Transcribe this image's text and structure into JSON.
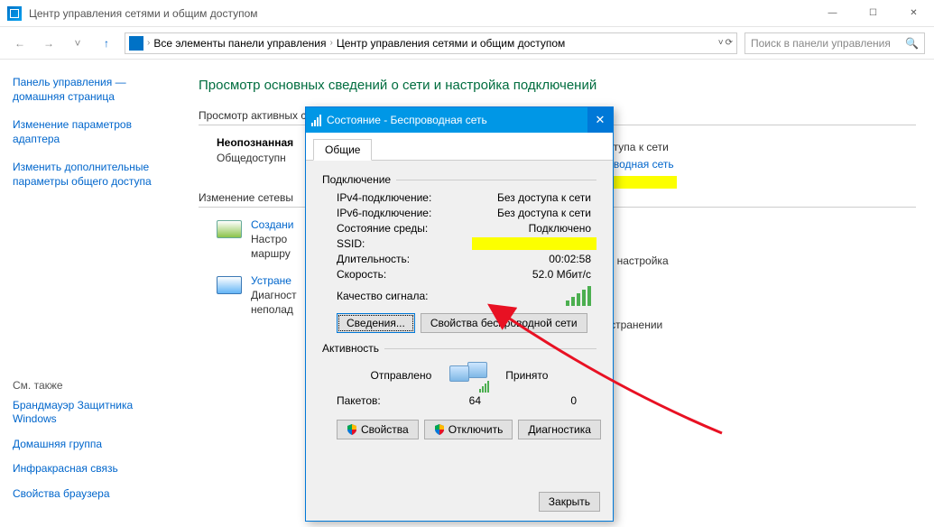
{
  "window": {
    "title": "Центр управления сетями и общим доступом",
    "min": "—",
    "max": "☐",
    "close": "✕"
  },
  "breadcrumb": {
    "item1": "Все элементы панели управления",
    "item2": "Центр управления сетями и общим доступом"
  },
  "search": {
    "placeholder": "Поиск в панели управления"
  },
  "sidebar": {
    "home": "Панель управления — домашняя страница",
    "adapter": "Изменение параметров адаптера",
    "sharing": "Изменить дополнительные параметры общего доступа",
    "related_title": "См. также",
    "related": {
      "firewall": "Брандмауэр Защитника Windows",
      "homegroup": "Домашняя группа",
      "ir": "Инфракрасная связь",
      "browser": "Свойства браузера"
    }
  },
  "content": {
    "heading": "Просмотр основных сведений о сети и настройка подключений",
    "active_networks": "Просмотр активных сетей",
    "network_name": "Неопознанная",
    "network_type": "Общедоступн",
    "access_label": "доступа к сети",
    "conn_label": "проводная сеть",
    "change_settings": "Изменение сетевы",
    "task1_title": "Создани",
    "task1_l1": "Настро",
    "task1_l2": "маршру",
    "task2_title": "Устране",
    "task2_l1": "Диагност",
    "task2_l2": "неполад",
    "task1_suffix": "ибо настройка",
    "task2_suffix": "б устранении"
  },
  "dialog": {
    "title": "Состояние - Беспроводная сеть",
    "tab": "Общие",
    "group_conn": "Подключение",
    "ipv4_k": "IPv4-подключение:",
    "ipv4_v": "Без доступа к сети",
    "ipv6_k": "IPv6-подключение:",
    "ipv6_v": "Без доступа к сети",
    "media_k": "Состояние среды:",
    "media_v": "Подключено",
    "ssid_k": "SSID:",
    "duration_k": "Длительность:",
    "duration_v": "00:02:58",
    "speed_k": "Скорость:",
    "speed_v": "52.0 Мбит/с",
    "quality_k": "Качество сигнала:",
    "btn_details": "Сведения...",
    "btn_wprops": "Свойства беспроводной сети",
    "group_activity": "Активность",
    "sent": "Отправлено",
    "recv": "Принято",
    "packets_k": "Пакетов:",
    "packets_sent": "64",
    "packets_recv": "0",
    "btn_props": "Свойства",
    "btn_disable": "Отключить",
    "btn_diag": "Диагностика",
    "btn_close": "Закрыть"
  }
}
